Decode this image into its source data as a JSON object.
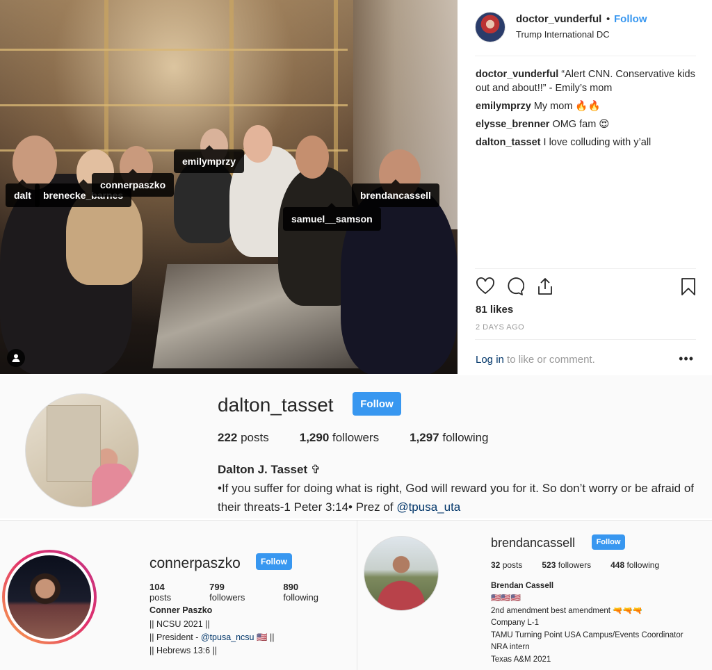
{
  "post": {
    "tags": [
      {
        "label": "dalt"
      },
      {
        "label": "brenecke_barnes"
      },
      {
        "label": "connerpaszko"
      },
      {
        "label": "emilymprzy"
      },
      {
        "label": "brendancassell"
      },
      {
        "label": "samuel__samson"
      }
    ],
    "header": {
      "username": "doctor_vunderful",
      "separator": "•",
      "follow_label": "Follow",
      "location": "Trump International DC"
    },
    "comments": [
      {
        "user": "doctor_vunderful",
        "text": "“Alert CNN. Conservative kids out and about!!” - Emily’s mom"
      },
      {
        "user": "emilymprzy",
        "text": "My mom 🔥🔥"
      },
      {
        "user": "elysse_brenner",
        "text": "OMG fam 😍"
      },
      {
        "user": "dalton_tasset",
        "text": "I love colluding with y’all"
      }
    ],
    "icons": [
      "heart-icon",
      "comment-icon",
      "share-icon",
      "bookmark-icon"
    ],
    "likes": "81 likes",
    "time": "2 DAYS AGO",
    "login_link": "Log in",
    "login_rest": " to like or comment.",
    "more": "•••"
  },
  "profiles": {
    "dalton": {
      "username": "dalton_tasset",
      "follow_label": "Follow",
      "posts": "222",
      "posts_label": " posts",
      "followers": "1,290",
      "followers_label": " followers",
      "following": "1,297",
      "following_label": " following",
      "name": "Dalton J. Tasset ✞",
      "bio": "•If you suffer for doing what is right, God will reward you for it. So don’t worry or be afraid of their threats-1 Peter 3:14• Prez of ",
      "mention": "@tpusa_uta"
    },
    "conner": {
      "username": "connerpaszko",
      "follow_label": "Follow",
      "posts": "104",
      "posts_label": " posts",
      "followers": "799",
      "followers_label": " followers",
      "following": "890",
      "following_label": " following",
      "name": "Conner Paszko",
      "bio_line1": "|| NCSU 2021 ||",
      "bio_line2_pre": "|| President - ",
      "bio_line2_mention": "@tpusa_ncsu",
      "bio_line2_post": " 🇺🇸 ||",
      "bio_line3": "|| Hebrews 13:6 ||"
    },
    "brendan": {
      "username": "brendancassell",
      "follow_label": "Follow",
      "posts": "32",
      "posts_label": " posts",
      "followers": "523",
      "followers_label": " followers",
      "following": "448",
      "following_label": " following",
      "name": "Brendan Cassell",
      "bio_lines": [
        "🇺🇸🇺🇸🇺🇸",
        "2nd amendment best amendment 🔫🔫🔫",
        "Company L-1",
        "TAMU Turning Point USA Campus/Events Coordinator",
        "NRA intern",
        "Texas A&M 2021"
      ]
    }
  }
}
